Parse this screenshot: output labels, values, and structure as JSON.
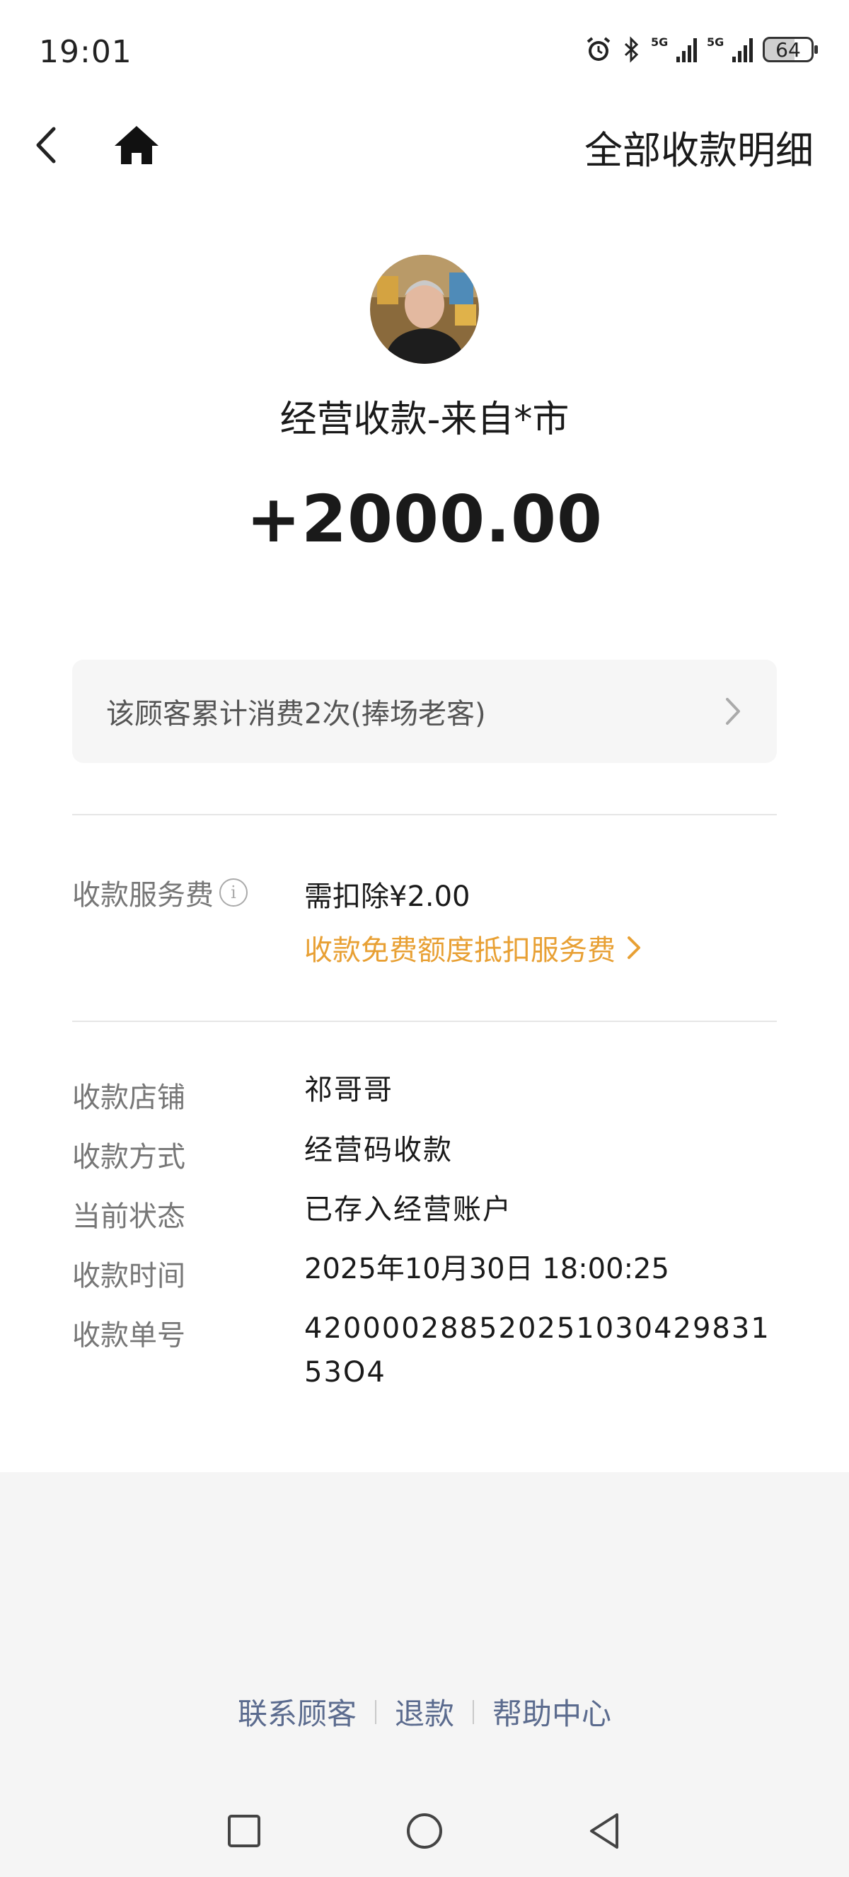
{
  "status_bar": {
    "time": "19:01",
    "network_label_1": "5G",
    "network_label_2": "5G",
    "battery_level": "64",
    "icons": [
      "alarm-icon",
      "bluetooth-icon",
      "signal-5g-icon",
      "signal-5g-icon",
      "battery-icon"
    ]
  },
  "nav": {
    "title": "全部收款明细",
    "back_icon": "chevron-left-icon",
    "home_icon": "home-icon"
  },
  "header": {
    "payer_title": "经营收款-来自*市",
    "amount": "+2000.00"
  },
  "customer_card": {
    "text": "该顾客累计消费2次(捧场老客)"
  },
  "fee": {
    "label": "收款服务费",
    "info_icon_glyph": "i",
    "value": "需扣除¥2.00",
    "link_text": "收款免费额度抵扣服务费",
    "link_color": "#e8a034"
  },
  "details": [
    {
      "label": "收款店铺",
      "value": "祁哥哥"
    },
    {
      "label": "收款方式",
      "value": "经营码收款"
    },
    {
      "label": "当前状态",
      "value": "已存入经营账户"
    },
    {
      "label": "收款时间",
      "value": "2025年10月30日 18:00:25"
    },
    {
      "label": "收款单号",
      "value": "42000028852025103042983153O4"
    }
  ],
  "footer": {
    "links": [
      "联系顾客",
      "退款",
      "帮助中心"
    ],
    "link_color": "#5b6b8e"
  },
  "system_nav": {
    "buttons": [
      "recent-apps-icon",
      "home-circle-icon",
      "back-triangle-icon"
    ]
  }
}
